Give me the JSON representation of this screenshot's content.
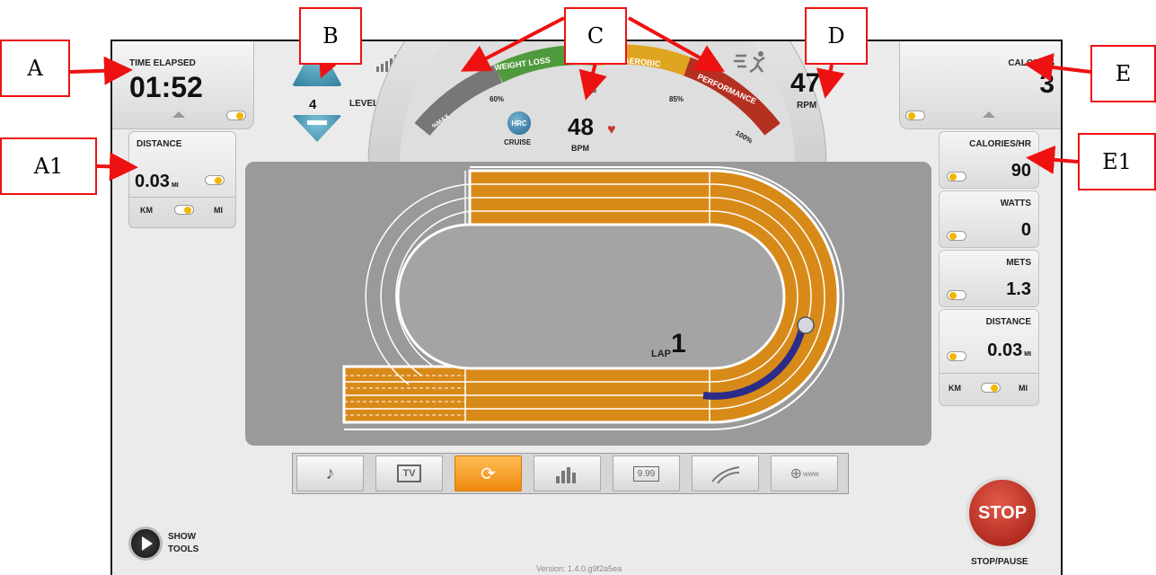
{
  "time_elapsed": {
    "label": "TIME ELAPSED",
    "value": "01:52"
  },
  "distance_left": {
    "label": "DISTANCE",
    "value": "0.03",
    "unit": "MI",
    "km": "KM",
    "mi": "MI"
  },
  "level": {
    "value": "4",
    "label": "LEVEL"
  },
  "heart_gauge": {
    "zone_weight_loss": "WEIGHT LOSS",
    "zone_aerobic": "AEROBIC",
    "zone_performance": "PERFORMANCE",
    "pct_max": "%MAX",
    "pct_60": "60%",
    "pct_75": "75",
    "pct_85": "85%",
    "pct_100": "100%",
    "bpm_value": "48",
    "bpm_label": "BPM",
    "hrc_label": "HRC",
    "cruise_label": "CRUISE"
  },
  "rpm": {
    "value": "47",
    "label": "RPM"
  },
  "calories": {
    "label": "CALORIES",
    "value": "3"
  },
  "right_stats": [
    {
      "label": "CALORIES/HR",
      "value": "90"
    },
    {
      "label": "WATTS",
      "value": "0"
    },
    {
      "label": "METS",
      "value": "1.3"
    },
    {
      "label": "DISTANCE",
      "value": "0.03",
      "unit": "MI"
    }
  ],
  "right_units": {
    "km": "KM",
    "mi": "MI"
  },
  "track": {
    "lap_label": "LAP",
    "lap_value": "1"
  },
  "toolbar": [
    {
      "name": "music-phone-icon",
      "active": false
    },
    {
      "name": "tv-icon",
      "active": true,
      "text": "TV"
    },
    {
      "name": "track-loop-icon",
      "active": true
    },
    {
      "name": "bar-profile-icon",
      "active": false
    },
    {
      "name": "digital-display-icon",
      "active": false,
      "text": "9.99"
    },
    {
      "name": "road-icon",
      "active": false
    },
    {
      "name": "web-icon",
      "active": false,
      "text": "www"
    }
  ],
  "show_tools": {
    "line1": "SHOW",
    "line2": "TOOLS"
  },
  "stop": {
    "button": "STOP",
    "label": "STOP/PAUSE"
  },
  "version": "Version: 1.4.0.g9f2a5ea",
  "callouts": {
    "a": "A",
    "a1": "A1",
    "b": "B",
    "c": "C",
    "d": "D",
    "e": "E",
    "e1": "E1"
  },
  "colors": {
    "track_orange": "#d88a18",
    "lane_line": "#ffffff",
    "progress": "#2b2b8a",
    "stop_red": "#c8261a",
    "accent_yellow": "#f2b600",
    "callout_red": "#e11111"
  }
}
